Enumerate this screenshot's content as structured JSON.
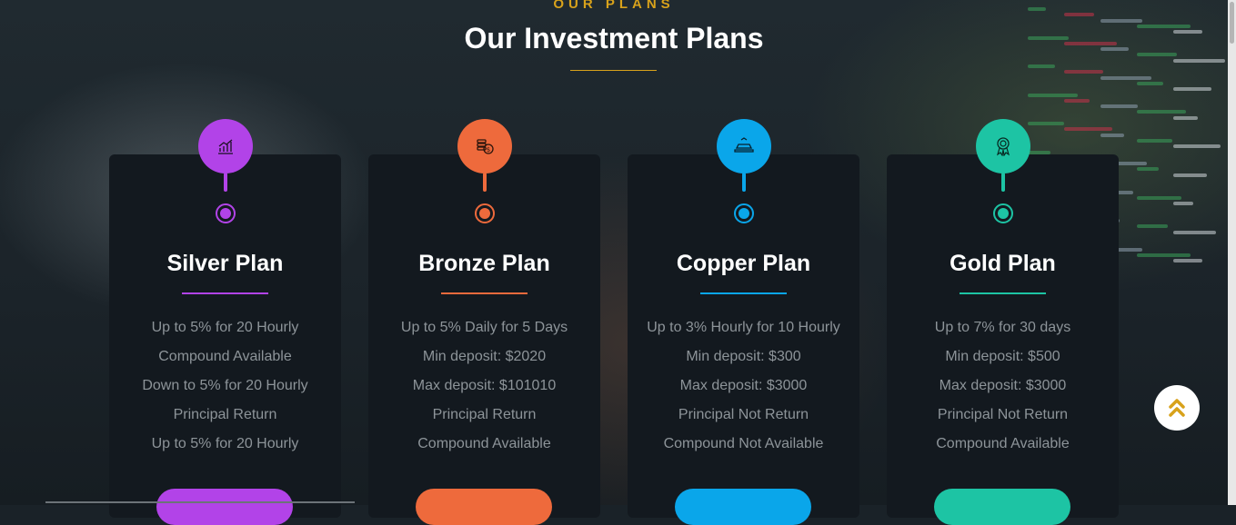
{
  "section": {
    "eyebrow": "OUR PLANS",
    "title": "Our Investment Plans",
    "accent_color": "#d8a21b"
  },
  "plans": [
    {
      "name": "Silver Plan",
      "color": "#b243e8",
      "icon": "chart-growth-icon",
      "features": [
        "Up to 5% for 20 Hourly",
        "Compound Available",
        "Down to 5% for 20 Hourly",
        "Principal Return",
        "Up to 5% for 20 Hourly"
      ]
    },
    {
      "name": "Bronze Plan",
      "color": "#ee6a3c",
      "icon": "coins-icon",
      "features": [
        "Up to 5% Daily for 5 Days",
        "Min deposit: $2020",
        "Max deposit: $101010",
        "Principal Return",
        "Compound Available"
      ]
    },
    {
      "name": "Copper Plan",
      "color": "#0aa6ea",
      "icon": "gold-bars-icon",
      "features": [
        "Up to 3% Hourly for 10 Hourly",
        "Min deposit: $300",
        "Max deposit: $3000",
        "Principal Not Return",
        "Compound Not Available"
      ]
    },
    {
      "name": "Gold Plan",
      "color": "#1dc4a4",
      "icon": "award-medal-icon",
      "features": [
        "Up to 7% for 30 days",
        "Min deposit: $500",
        "Max deposit: $3000",
        "Principal Not Return",
        "Compound Available"
      ]
    }
  ],
  "back_to_top": {
    "icon": "double-chevron-up-icon",
    "color": "#d8a21b"
  }
}
